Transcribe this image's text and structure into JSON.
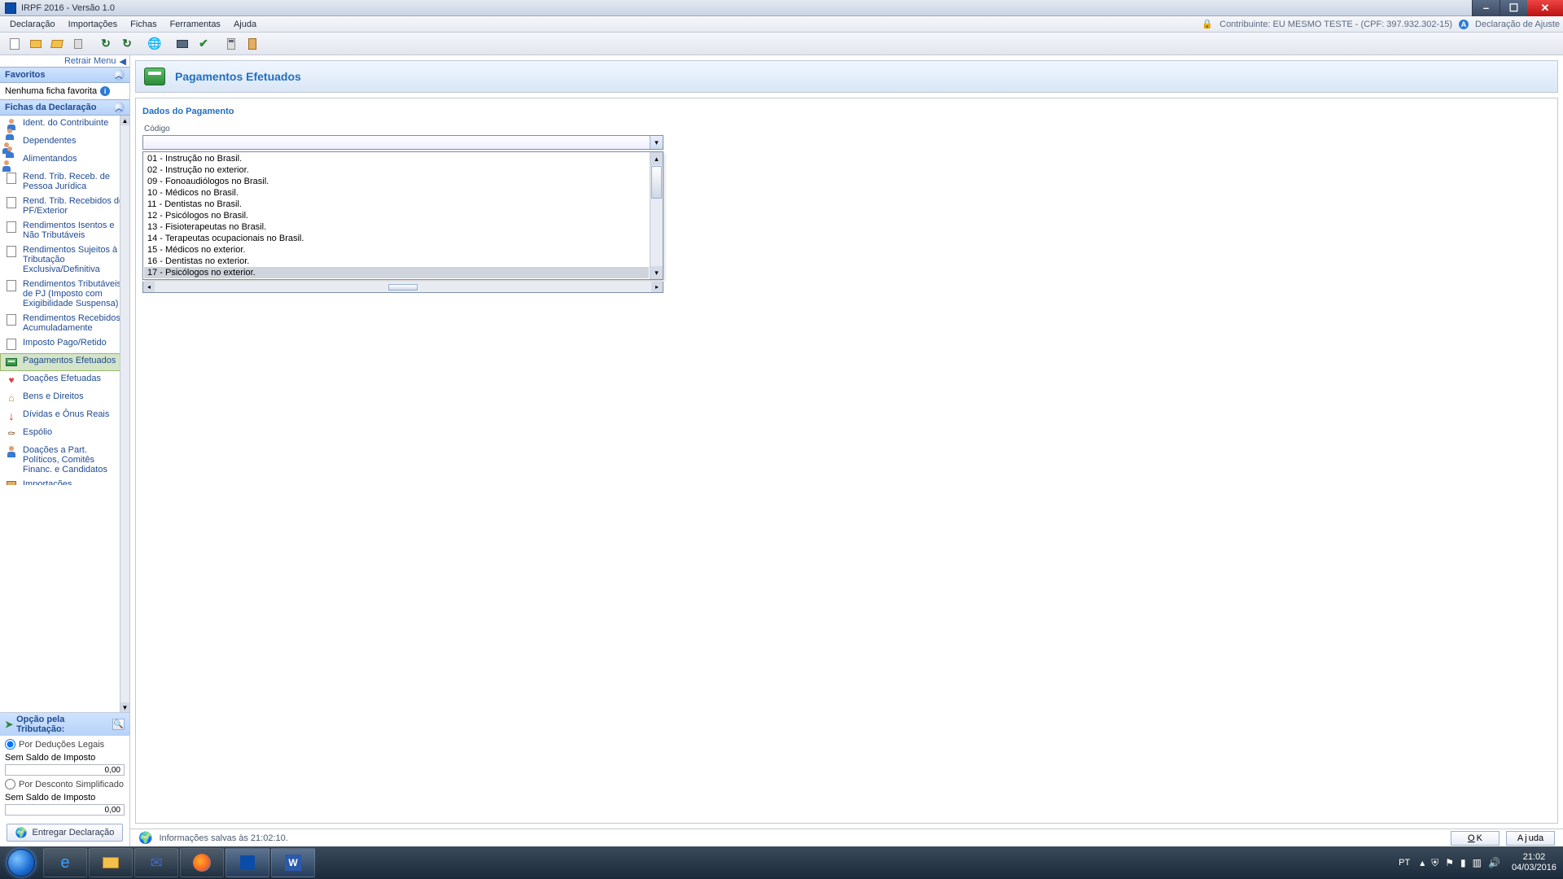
{
  "window": {
    "title": "IRPF 2016 - Versão 1.0"
  },
  "menu": {
    "items": [
      "Declaração",
      "Importações",
      "Fichas",
      "Ferramentas",
      "Ajuda"
    ]
  },
  "header_info": {
    "contribuinte_label": "Contribuinte: EU MESMO TESTE - (CPF: 397.932.302-15)",
    "decl_type": "Declaração de Ajuste"
  },
  "sidebar": {
    "retrair": "Retrair Menu",
    "favoritos_title": "Favoritos",
    "favoritos_empty": "Nenhuma ficha favorita",
    "fichas_title": "Fichas da Declaração",
    "fichas": [
      {
        "label": "Ident. do Contribuinte",
        "icon": "person"
      },
      {
        "label": "Dependentes",
        "icon": "people"
      },
      {
        "label": "Alimentandos",
        "icon": "people"
      },
      {
        "label": "Rend. Trib. Receb. de Pessoa Jurídica",
        "icon": "doc"
      },
      {
        "label": "Rend. Trib. Recebidos de PF/Exterior",
        "icon": "doc"
      },
      {
        "label": "Rendimentos Isentos e Não Tributáveis",
        "icon": "doc"
      },
      {
        "label": "Rendimentos Sujeitos à Tributação Exclusiva/Definitiva",
        "icon": "doc"
      },
      {
        "label": "Rendimentos Tributáveis de PJ (Imposto com Exigibilidade Suspensa)",
        "icon": "doc"
      },
      {
        "label": "Rendimentos Recebidos Acumuladamente",
        "icon": "doc"
      },
      {
        "label": "Imposto Pago/Retido",
        "icon": "doc"
      },
      {
        "label": "Pagamentos Efetuados",
        "icon": "card",
        "active": true
      },
      {
        "label": "Doações Efetuadas",
        "icon": "heart"
      },
      {
        "label": "Bens e Direitos",
        "icon": "house"
      },
      {
        "label": "Dívidas e Ônus Reais",
        "icon": "arrowdown"
      },
      {
        "label": "Espólio",
        "icon": "coffin"
      },
      {
        "label": "Doações a Part. Políticos, Comitês Financ. e Candidatos",
        "icon": "person"
      },
      {
        "label": "Importações",
        "icon": "box"
      }
    ],
    "tributacao": {
      "title": "Opção pela Tributação:",
      "opt1": "Por Deduções Legais",
      "opt1_selected": true,
      "saldo1_label": "Sem Saldo de Imposto",
      "saldo1_value": "0,00",
      "opt2": "Por Desconto Simplificado",
      "saldo2_label": "Sem Saldo de Imposto",
      "saldo2_value": "0,00"
    },
    "deliver": "Entregar Declaração"
  },
  "page": {
    "title": "Pagamentos Efetuados",
    "section": "Dados do Pagamento",
    "codigo_label": "Código",
    "dropdown": [
      "01 - Instrução no Brasil.",
      "02 - Instrução no exterior.",
      "09 - Fonoaudiólogos no Brasil.",
      "10 - Médicos no Brasil.",
      "11 - Dentistas no Brasil.",
      "12 - Psicólogos no Brasil.",
      "13 - Fisioterapeutas no Brasil.",
      "14 - Terapeutas ocupacionais no Brasil.",
      "15 - Médicos no exterior.",
      "16 - Dentistas no exterior.",
      "17 - Psicólogos no exterior."
    ],
    "hovered_index": 10
  },
  "status": {
    "msg": "Informações salvas às 21:02:10.",
    "ok": "OK",
    "ajuda": "Ajuda"
  },
  "taskbar": {
    "lang": "PT",
    "time": "21:02",
    "date": "04/03/2016"
  }
}
